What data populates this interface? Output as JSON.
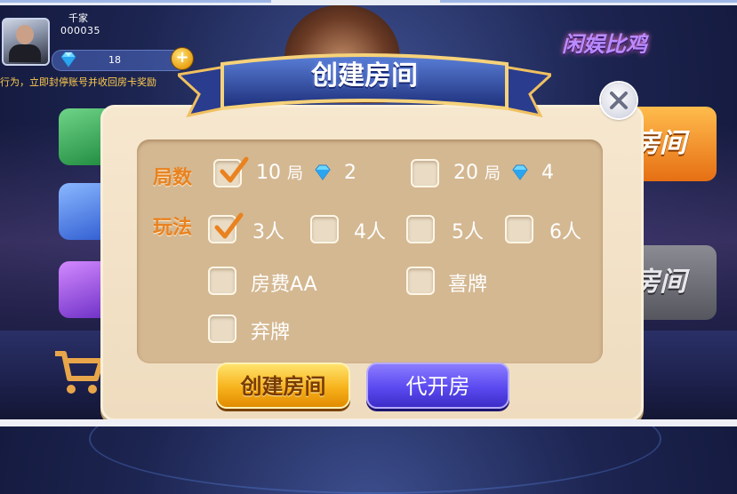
{
  "user": {
    "name": "千家",
    "id": "000035",
    "gems": "18",
    "add_button": "+"
  },
  "notice_text": "行为，立即封停账号并收回房卡奖励",
  "brand_logo": "闲娱比鸡",
  "right_buttons": [
    "房间",
    "房间"
  ],
  "dialog": {
    "title": "创建房间",
    "close_icon": "close-icon",
    "rounds_label": "局数",
    "rounds_options": [
      {
        "rounds": "10",
        "unit": "局",
        "cost": "2",
        "checked": true
      },
      {
        "rounds": "20",
        "unit": "局",
        "cost": "4",
        "checked": false
      }
    ],
    "rules_label": "玩法",
    "player_options": [
      {
        "label": "3人",
        "checked": true
      },
      {
        "label": "4人",
        "checked": false
      },
      {
        "label": "5人",
        "checked": false
      },
      {
        "label": "6人",
        "checked": false
      }
    ],
    "extra_options": [
      {
        "label": "房费AA",
        "checked": false
      },
      {
        "label": "喜牌",
        "checked": false
      },
      {
        "label": "弃牌",
        "checked": false
      }
    ],
    "create_button": "创建房间",
    "proxy_button": "代开房"
  },
  "colors": {
    "accent_orange": "#e9821f",
    "create_gold": "#f7b21c",
    "proxy_purple": "#5b4af0",
    "dialog_bg": "#f6e7cf",
    "panel_bg": "#d4b892"
  }
}
